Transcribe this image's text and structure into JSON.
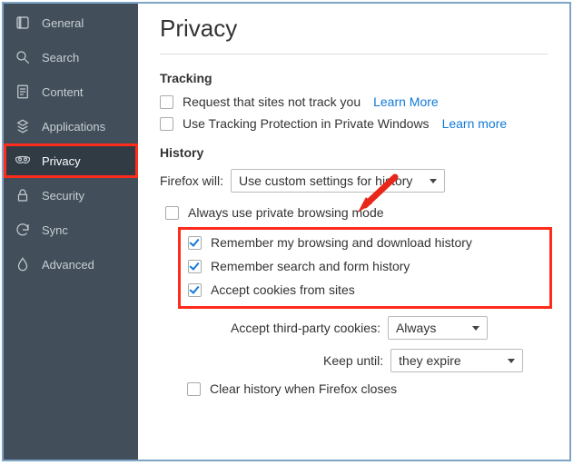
{
  "sidebar": {
    "items": [
      {
        "label": "General"
      },
      {
        "label": "Search"
      },
      {
        "label": "Content"
      },
      {
        "label": "Applications"
      },
      {
        "label": "Privacy"
      },
      {
        "label": "Security"
      },
      {
        "label": "Sync"
      },
      {
        "label": "Advanced"
      }
    ]
  },
  "page": {
    "title": "Privacy"
  },
  "tracking": {
    "heading": "Tracking",
    "dnt_label": "Request that sites not track you",
    "dnt_link": "Learn More",
    "tp_label": "Use Tracking Protection in Private Windows",
    "tp_link": "Learn more"
  },
  "history": {
    "heading": "History",
    "will_label": "Firefox will:",
    "will_value": "Use custom settings for history",
    "private_label": "Always use private browsing mode",
    "remember_browsing": "Remember my browsing and download history",
    "remember_search": "Remember search and form history",
    "accept_cookies": "Accept cookies from sites",
    "third_party_label": "Accept third-party cookies:",
    "third_party_value": "Always",
    "keep_label": "Keep until:",
    "keep_value": "they expire",
    "clear_on_close": "Clear history when Firefox closes"
  }
}
